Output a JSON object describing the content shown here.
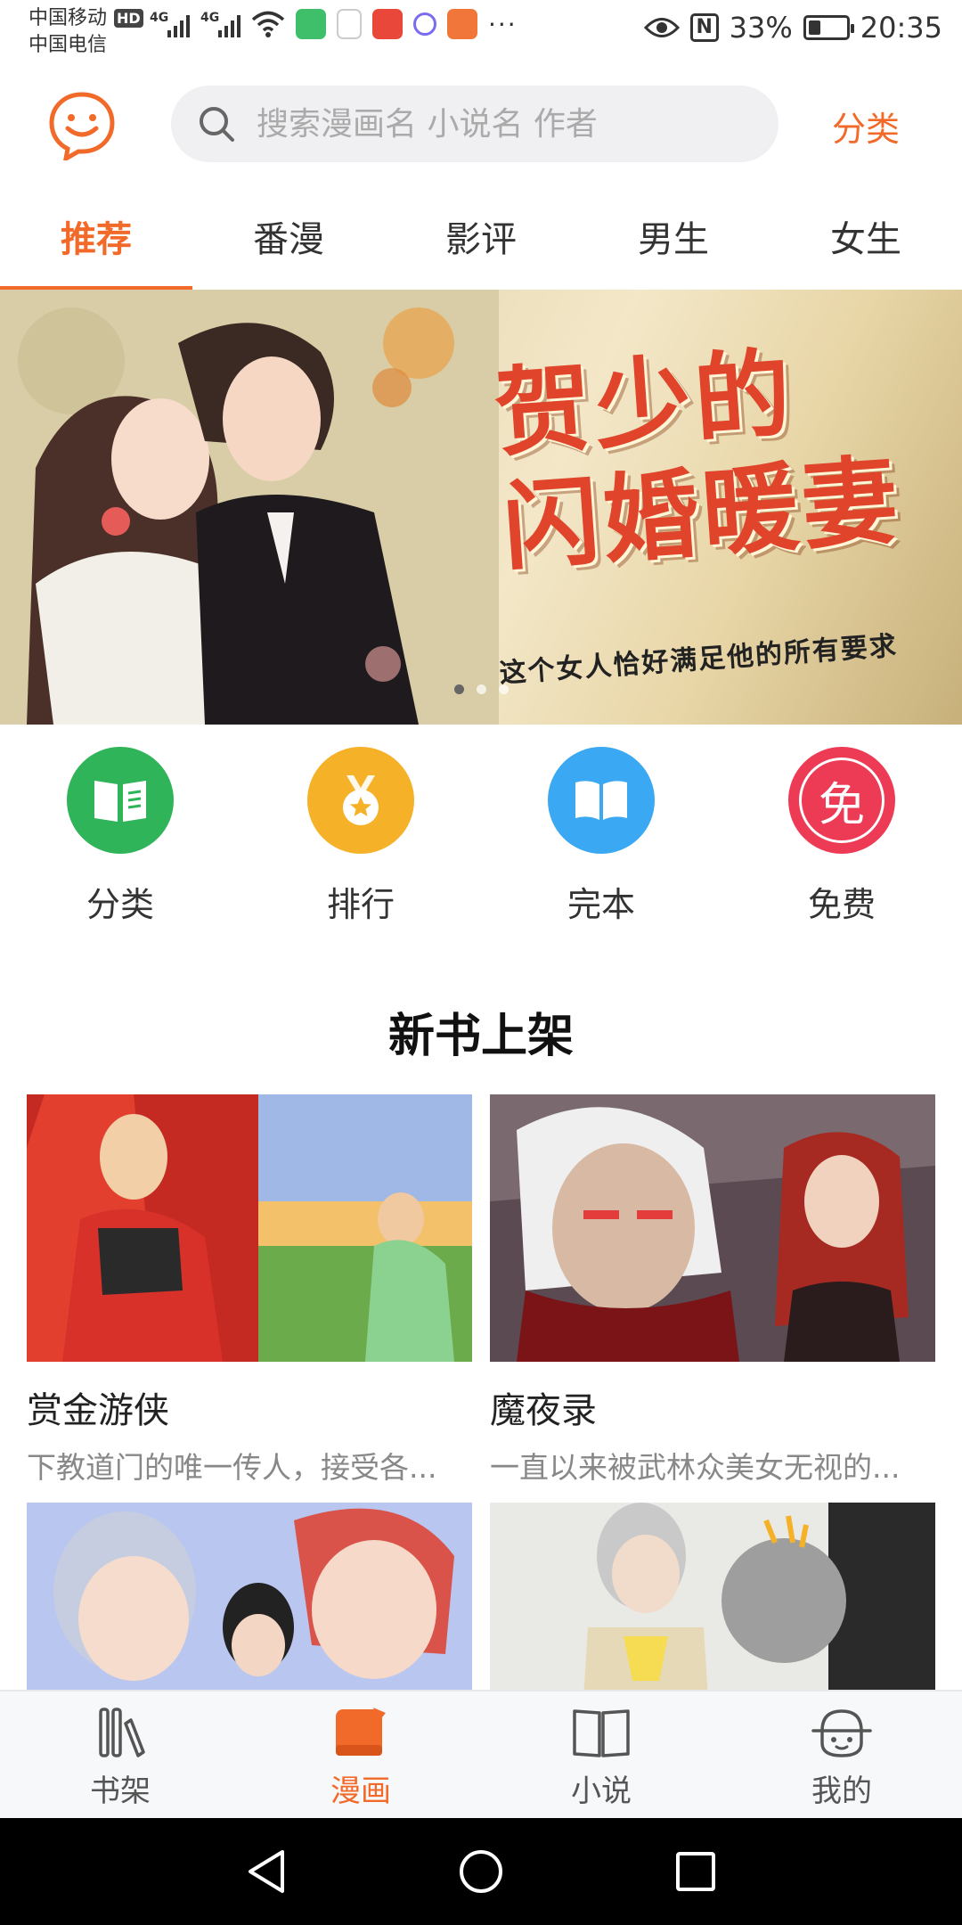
{
  "status_bar": {
    "carrier_1": "中国移动",
    "carrier_2": "中国电信",
    "hd": "HD",
    "network_1": "4G",
    "network_2": "4G",
    "more": "···",
    "battery_text": "33%",
    "battery_level": 0.33,
    "time": "20:35",
    "nfc": "N"
  },
  "header": {
    "search_placeholder": "搜索漫画名 小说名 作者",
    "category_link": "分类"
  },
  "tabs": [
    {
      "label": "推荐",
      "active": true
    },
    {
      "label": "番漫"
    },
    {
      "label": "影评"
    },
    {
      "label": "男生"
    },
    {
      "label": "女生"
    }
  ],
  "banner": {
    "title": "贺少的\n闪婚暖妻",
    "subtitle": "这个女人恰好满足他的所有要求"
  },
  "quick_links": [
    {
      "label": "分类",
      "icon": "book-icon",
      "color": "#2fb45a"
    },
    {
      "label": "排行",
      "icon": "medal-icon",
      "color": "#f5b229"
    },
    {
      "label": "完本",
      "icon": "open-book-icon",
      "color": "#3aa8f2"
    },
    {
      "label": "免费",
      "icon": "free-badge-icon",
      "color": "#ee3b55",
      "glyph": "免"
    }
  ],
  "section": {
    "title": "新书上架"
  },
  "books": [
    {
      "title": "赏金游侠",
      "desc": "下教道门的唯一传人，接受各..."
    },
    {
      "title": "魔夜录",
      "desc": "一直以来被武林众美女无视的..."
    },
    {
      "title": "",
      "desc": ""
    },
    {
      "title": "",
      "desc": ""
    }
  ],
  "bottom_nav": [
    {
      "label": "书架",
      "icon": "bookshelf-icon"
    },
    {
      "label": "漫画",
      "icon": "comic-icon",
      "active": true
    },
    {
      "label": "小说",
      "icon": "novel-icon"
    },
    {
      "label": "我的",
      "icon": "profile-icon"
    }
  ],
  "colors": {
    "accent": "#f26a29"
  }
}
